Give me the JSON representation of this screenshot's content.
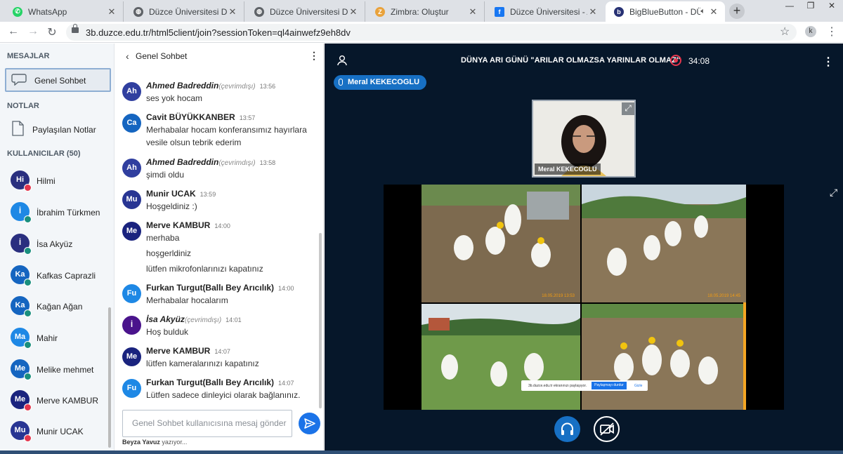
{
  "browser": {
    "tabs": [
      {
        "title": "WhatsApp",
        "color": "#25d366"
      },
      {
        "title": "Düzce Üniversitesi Düzce",
        "color": "#5f6368"
      },
      {
        "title": "Düzce Üniversitesi Düzce",
        "color": "#5f6368"
      },
      {
        "title": "Zimbra: Oluştur",
        "color": "#e9a23b"
      },
      {
        "title": "Düzce Üniversitesi - Ana",
        "color": "#1877f2"
      },
      {
        "title": "BigBlueButton - DÜ",
        "color": "#283274"
      }
    ],
    "url": "3b.duzce.edu.tr/html5client/join?sessionToken=ql4ainwefz9eh8dv",
    "profile_initial": "k"
  },
  "sidebar": {
    "messages_header": "MESAJLAR",
    "public_chat_label": "Genel Sohbet",
    "notes_header": "NOTLAR",
    "shared_notes_label": "Paylaşılan Notlar",
    "users_header": "KULLANICILAR (50)",
    "users": [
      {
        "initials": "Hi",
        "name": "Hilmi",
        "color": "#2a2f7f",
        "status": "muted"
      },
      {
        "initials": "İ",
        "name": "İbrahim Türkmen",
        "color": "#1e88e5",
        "status": "listen"
      },
      {
        "initials": "İ",
        "name": "İsa Akyüz",
        "color": "#2a2f7f",
        "status": "listen"
      },
      {
        "initials": "Ka",
        "name": "Kafkas Caprazli",
        "color": "#1565c0",
        "status": "listen"
      },
      {
        "initials": "Ka",
        "name": "Kağan Ağan",
        "color": "#1565c0",
        "status": "listen"
      },
      {
        "initials": "Ma",
        "name": "Mahir",
        "color": "#1e88e5",
        "status": "listen"
      },
      {
        "initials": "Me",
        "name": "Melike mehmet",
        "color": "#1565c0",
        "status": "listen"
      },
      {
        "initials": "Me",
        "name": "Merve KAMBUR",
        "color": "#1a237e",
        "status": "muted"
      },
      {
        "initials": "Mu",
        "name": "Munir UCAK",
        "color": "#283593",
        "status": "muted"
      }
    ]
  },
  "chat": {
    "title": "Genel Sohbet",
    "messages": [
      {
        "initials": "Ah",
        "name": "Ahmed Badreddin",
        "offline": "(çevrimdışı)",
        "time": "13:56",
        "lines": [
          "ses yok hocam"
        ],
        "color": "#303f9f"
      },
      {
        "initials": "Ca",
        "name": "Cavit BÜYÜKKANBER",
        "offline": "",
        "time": "13:57",
        "lines": [
          "Merhabalar hocam konferansımız hayırlara",
          "vesile olsun tebrik ederim"
        ],
        "color": "#1565c0"
      },
      {
        "initials": "Ah",
        "name": "Ahmed Badreddin",
        "offline": "(çevrimdışı)",
        "time": "13:58",
        "lines": [
          "şimdi oldu"
        ],
        "color": "#303f9f"
      },
      {
        "initials": "Mu",
        "name": "Munir UCAK",
        "offline": "",
        "time": "13:59",
        "lines": [
          "Hoşgeldiniz :)"
        ],
        "color": "#283593"
      },
      {
        "initials": "Me",
        "name": "Merve KAMBUR",
        "offline": "",
        "time": "14:00",
        "lines": [
          "merhaba",
          "hoşgerldiniz",
          "lütfen mikrofonlarınızı kapatınız"
        ],
        "color": "#1a237e"
      },
      {
        "initials": "Fu",
        "name": "Furkan Turgut(Ballı Bey Arıcılık)",
        "offline": "",
        "time": "14:00",
        "lines": [
          "Merhabalar hocalarım"
        ],
        "color": "#1e88e5"
      },
      {
        "initials": "İ",
        "name": "İsa Akyüz",
        "offline": "(çevrimdışı)",
        "time": "14:01",
        "lines": [
          "Hoş bulduk"
        ],
        "color": "#4a148c"
      },
      {
        "initials": "Me",
        "name": "Merve KAMBUR",
        "offline": "",
        "time": "14:07",
        "lines": [
          "lütfen kameralarınızı kapatınız"
        ],
        "color": "#1a237e"
      },
      {
        "initials": "Fu",
        "name": "Furkan Turgut(Ballı Bey Arıcılık)",
        "offline": "",
        "time": "14:07",
        "lines": [
          "Lütfen sadece dinleyici olarak bağlanınız."
        ],
        "color": "#1e88e5"
      }
    ],
    "input_placeholder": "Genel Sohbet kullanıcısına mesaj gönder",
    "typing_user": "Beyza Yavuz",
    "typing_text": " yazıyor..."
  },
  "meeting": {
    "title": "DÜNYA ARI GÜNÜ \"ARILAR OLMAZSA YARINLAR OLMAZ\"",
    "record_time": "34:08",
    "talker": "Meral KEKECOGLU",
    "webcam_name": "Meral KEKECOGLU",
    "share_notice": "3b.duzce.edu.tr ekranınızı paylaşıyor.",
    "share_stop": "Paylaşmayı durdur",
    "share_hide": "Gizle",
    "photo_dates": [
      "18.05.2019 13:53",
      "18.05.2019 14:45"
    ]
  },
  "colors": {
    "accent": "#1b73e8",
    "muted_badge": "#e4364d",
    "listen_badge": "#1a8f7e",
    "meeting_bg": "#06172a"
  }
}
